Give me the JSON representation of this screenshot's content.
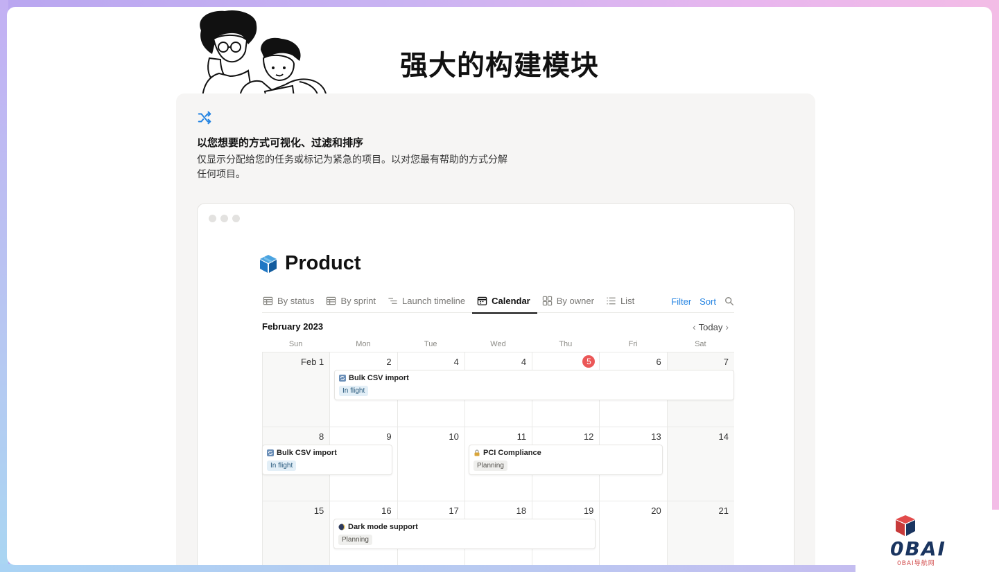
{
  "hero": {
    "title": "强大的构建模块"
  },
  "panel": {
    "icon": "shuffle-icon",
    "heading": "以您想要的方式可视化、过滤和排序",
    "description": "仅显示分配给您的任务或标记为紧急的项目。以对您最有帮助的方式分解任何项目。"
  },
  "app": {
    "title": "Product",
    "title_icon": "cube-icon",
    "tabs": [
      {
        "label": "By status",
        "icon": "table-icon"
      },
      {
        "label": "By sprint",
        "icon": "table-icon"
      },
      {
        "label": "Launch timeline",
        "icon": "timeline-icon"
      },
      {
        "label": "Calendar",
        "icon": "calendar-icon",
        "active": true
      },
      {
        "label": "By owner",
        "icon": "gallery-icon"
      },
      {
        "label": "List",
        "icon": "list-icon"
      }
    ],
    "actions": {
      "filter": "Filter",
      "sort": "Sort",
      "search_icon": "search-icon"
    },
    "calendar": {
      "month": "February 2023",
      "today_label": "Today",
      "weekdays": [
        "Sun",
        "Mon",
        "Tue",
        "Wed",
        "Thu",
        "Fri",
        "Sat"
      ],
      "weeks": [
        [
          "Feb 1",
          "2",
          "4",
          "4",
          "5",
          "6",
          "7"
        ],
        [
          "8",
          "9",
          "10",
          "11",
          "12",
          "13",
          "14"
        ],
        [
          "15",
          "16",
          "17",
          "18",
          "19",
          "20",
          "21"
        ]
      ],
      "today_date": "5",
      "events": [
        {
          "title": "Bulk CSV import",
          "tag": "In flight"
        },
        {
          "title": "Bulk CSV import",
          "tag": "In flight"
        },
        {
          "title": "PCI Compliance",
          "tag": "Planning"
        },
        {
          "title": "Dark mode support",
          "tag": "Planning"
        }
      ]
    }
  },
  "colors": {
    "accent": "#2383e2",
    "today": "#eb5757",
    "brand": "#1a3560",
    "brand_red": "#e24b4b"
  },
  "brand": {
    "name": "0BAI",
    "subtitle": "0BAI导航网"
  }
}
